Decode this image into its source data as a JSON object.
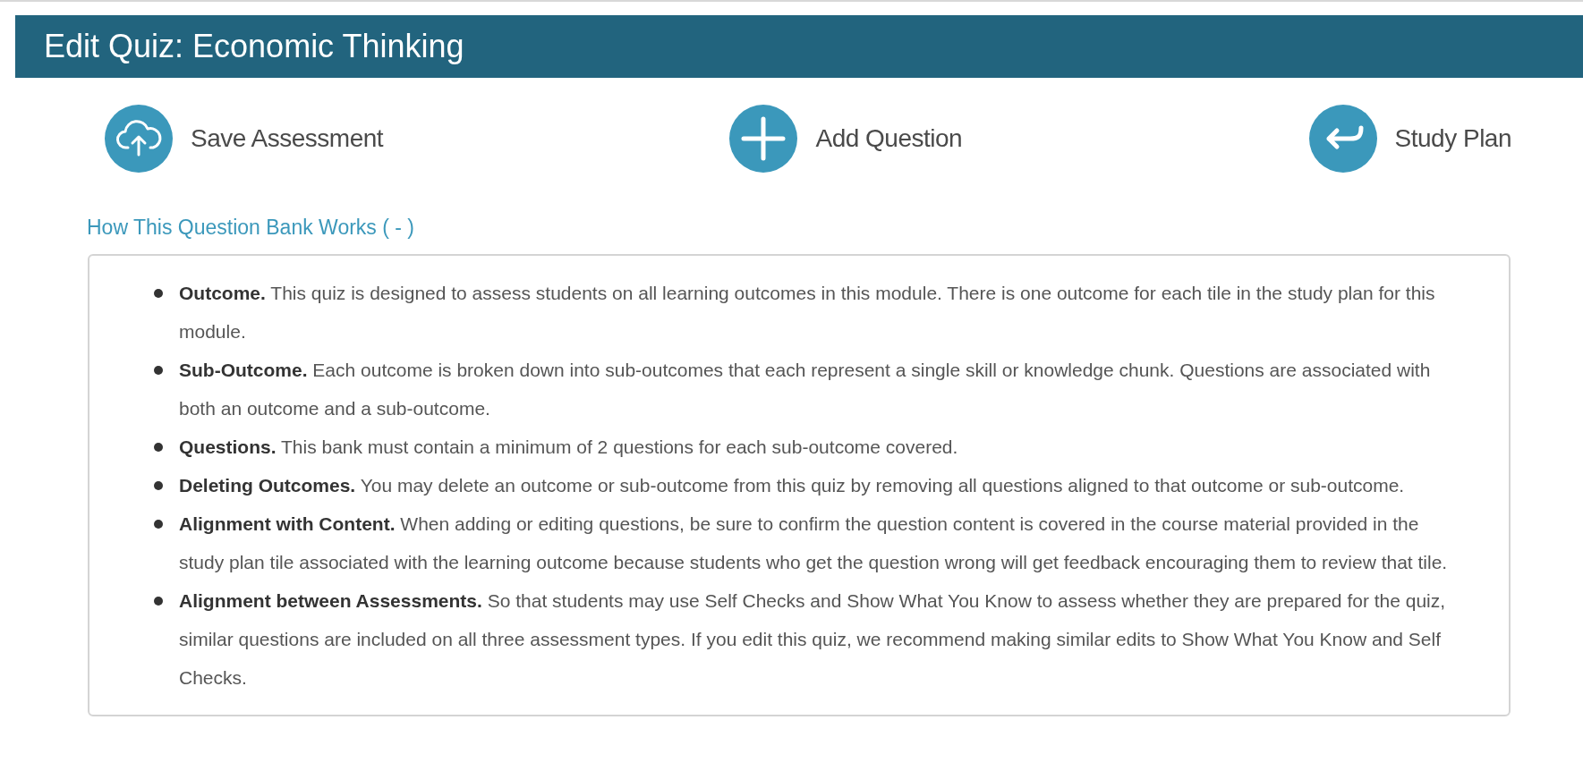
{
  "header": {
    "title": "Edit Quiz: Economic Thinking"
  },
  "actions": [
    {
      "kind": "upload",
      "label": "Save Assessment"
    },
    {
      "kind": "add",
      "label": "Add Question"
    },
    {
      "kind": "return",
      "label": "Study Plan"
    }
  ],
  "info": {
    "toggle": "How This Question Bank Works ( - )",
    "items": [
      "**Outcome.** This quiz is designed to assess students on all learning outcomes in this module. There is one outcome for each tile in the study plan for this module.",
      "**Sub-Outcome.** Each outcome is broken down into sub-outcomes that each represent a single skill or knowledge chunk. Questions are associated with both an outcome and a sub-outcome.",
      "**Questions.** This bank must contain a minimum of 2 questions for each sub-outcome covered.",
      "**Deleting Outcomes.** You may delete an outcome or sub-outcome from this quiz by removing all questions aligned to that outcome or sub-outcome.",
      "**Alignment with Content.** When adding or editing questions, be sure to confirm the question content is covered in the course material provided in the study plan tile associated with the learning outcome because students who get the question wrong will get feedback encouraging them to review that tile.",
      "**Alignment between Assessments.** So that students may use Self Checks and Show What You Know to assess whether they are prepared for the quiz, similar questions are included on all three assessment types. If you edit this quiz, we recommend making similar edits to Show What You Know and Self Checks."
    ]
  }
}
